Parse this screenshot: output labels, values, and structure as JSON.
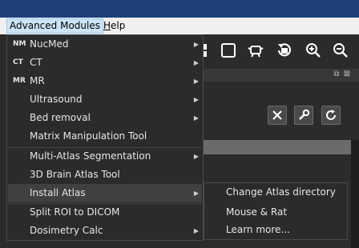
{
  "menubar": {
    "items": [
      {
        "label": "Advanced Modules",
        "active": true
      },
      {
        "label": "Help",
        "underline": "H",
        "rest": "elp"
      }
    ]
  },
  "toolbar": {
    "icons": [
      "grid-icon",
      "square-icon",
      "robot-icon",
      "rotate-view-icon",
      "zoom-in-icon",
      "zoom-out-icon"
    ]
  },
  "panel": {
    "controls": [
      "restore-icon",
      "close-icon"
    ],
    "buttons": [
      {
        "name": "close-button",
        "icon": "x-icon"
      },
      {
        "name": "settings-button",
        "icon": "wrench-icon"
      },
      {
        "name": "refresh-button",
        "icon": "refresh-icon"
      }
    ]
  },
  "menu": {
    "items": [
      {
        "tag": "NM",
        "label": "NucMed",
        "submenu": true
      },
      {
        "tag": "CT",
        "label": "CT",
        "submenu": true
      },
      {
        "tag": "MR",
        "label": "MR",
        "submenu": true
      },
      {
        "tag": "",
        "label": "Ultrasound",
        "submenu": true
      },
      {
        "tag": "",
        "label": "Bed removal",
        "submenu": true
      },
      {
        "tag": "",
        "label": "Matrix Manipulation Tool",
        "submenu": false
      },
      {
        "tag": "",
        "label": "Multi-Atlas Segmentation",
        "submenu": true
      },
      {
        "tag": "",
        "label": "3D Brain Atlas Tool",
        "submenu": false
      },
      {
        "tag": "",
        "label": "Install Atlas",
        "submenu": true,
        "highlighted": true
      },
      {
        "tag": "",
        "label": "Split ROI to DICOM",
        "submenu": false
      },
      {
        "tag": "",
        "label": "Dosimetry Calc",
        "submenu": true
      }
    ]
  },
  "submenu": {
    "items": [
      "Change Atlas directory",
      "Mouse & Rat",
      "Learn more..."
    ]
  },
  "colors": {
    "titlebar": "#1f3f7a",
    "menu_bg": "#2b2b2b",
    "highlight": "#404040",
    "menubar_bg": "#f0f0f0"
  }
}
